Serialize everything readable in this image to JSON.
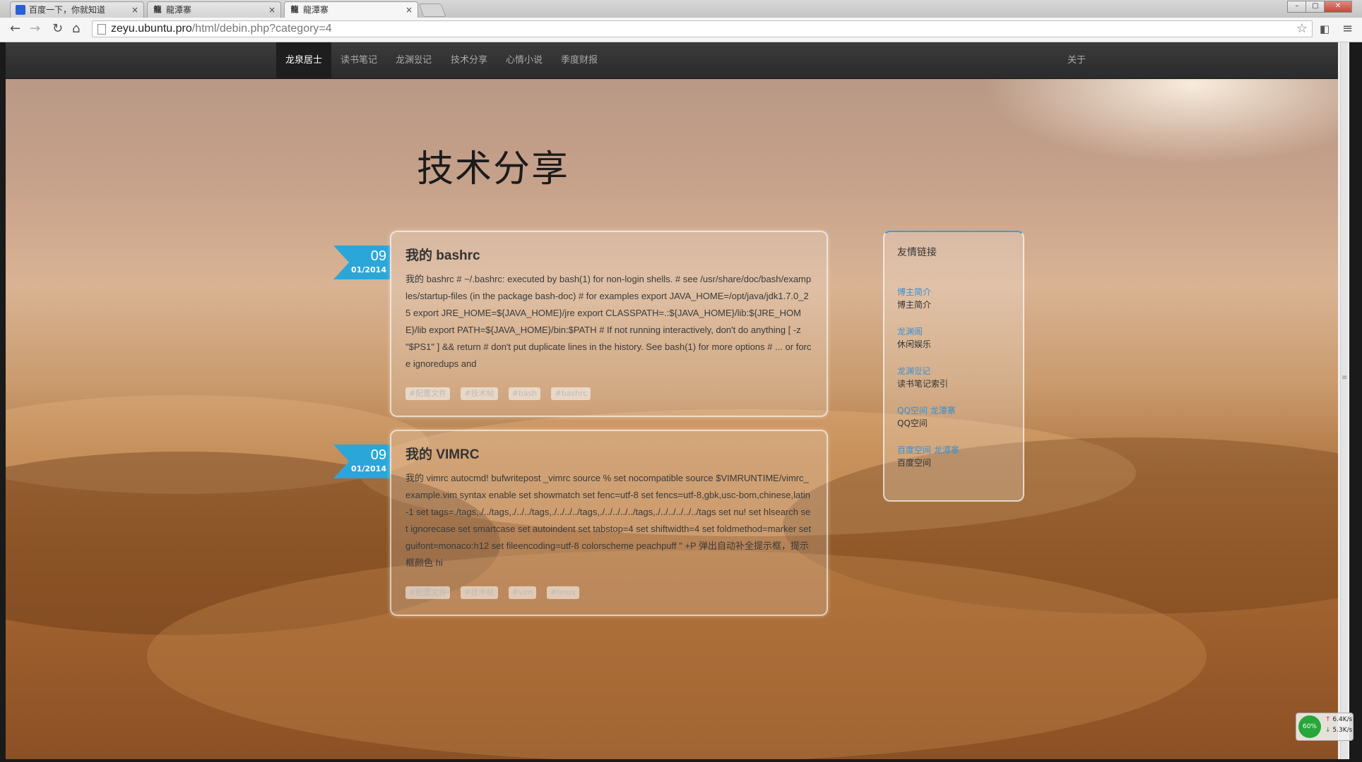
{
  "browser": {
    "tabs": [
      {
        "title": "百度一下，你就知道",
        "active": false
      },
      {
        "title": "龍潭寨",
        "active": false
      },
      {
        "title": "龍潭寨",
        "active": true
      }
    ],
    "url_host": "zeyu.ubuntu.pro",
    "url_path": "/html/debin.php?category=4"
  },
  "nav": {
    "items": [
      "龙泉居士",
      "读书笔记",
      "龙渊읬记",
      "技术分享",
      "心情小说",
      "季度财报"
    ],
    "about": "关于",
    "active_index": 0
  },
  "page": {
    "title": "技术分享"
  },
  "posts": [
    {
      "day": "09",
      "date": "01/2014",
      "title": "我的 bashrc",
      "excerpt": "我的 bashrc # ~/.bashrc: executed by bash(1) for non-login shells. # see /usr/share/doc/bash/examples/startup-files (in the package bash-doc) # for examples export JAVA_HOME=/opt/java/jdk1.7.0_25 export JRE_HOME=${JAVA_HOME}/jre export CLASSPATH=.:${JAVA_HOME}/lib:${JRE_HOME}/lib export PATH=${JAVA_HOME}/bin:$PATH # If not running interactively, don't do anything [ -z \"$PS1\" ] && return # don't put duplicate lines in the history. See bash(1) for more options # ... or force ignoredups and",
      "tags": [
        "#配置文件",
        "#技术帖",
        "#bash",
        "#bashrc"
      ]
    },
    {
      "day": "09",
      "date": "01/2014",
      "title": "我的 VIMRC",
      "excerpt": "我的 vimrc autocmd! bufwritepost _vimrc source % set nocompatible source $VIMRUNTIME/vimrc_example.vim syntax enable set showmatch set fenc=utf-8 set fencs=utf-8,gbk,usc-bom,chinese,latin-1 set tags=./tags,./../tags,./../../tags,./../../../tags,./../../../../tags,./../../../../../tags set nu! set hlsearch set ignorecase set smartcase set autoindent set tabstop=4 set shiftwidth=4 set foldmethod=marker set guifont=monaco:h12 set fileencoding=utf-8 colorscheme peachpuff \" +P 弹出自动补全提示框，提示框颜色 hi",
      "tags": [
        "#配置文件",
        "#技术帖",
        "#vim",
        "#linux"
      ]
    }
  ],
  "sidebar": {
    "heading": "友情链接",
    "links": [
      {
        "name": "博主简介",
        "desc": "博主简介"
      },
      {
        "name": "龙渊阁",
        "desc": "休闲娱乐"
      },
      {
        "name": "龙渊읬记",
        "desc": "读书笔记索引"
      },
      {
        "name": "QQ空间 龙潭寨",
        "desc": "QQ空间"
      },
      {
        "name": "百度空间 龙潭寨",
        "desc": "百度空间"
      }
    ]
  },
  "netmeter": {
    "percent": "60%",
    "up": "6.4K/s",
    "down": "5.3K/s"
  }
}
